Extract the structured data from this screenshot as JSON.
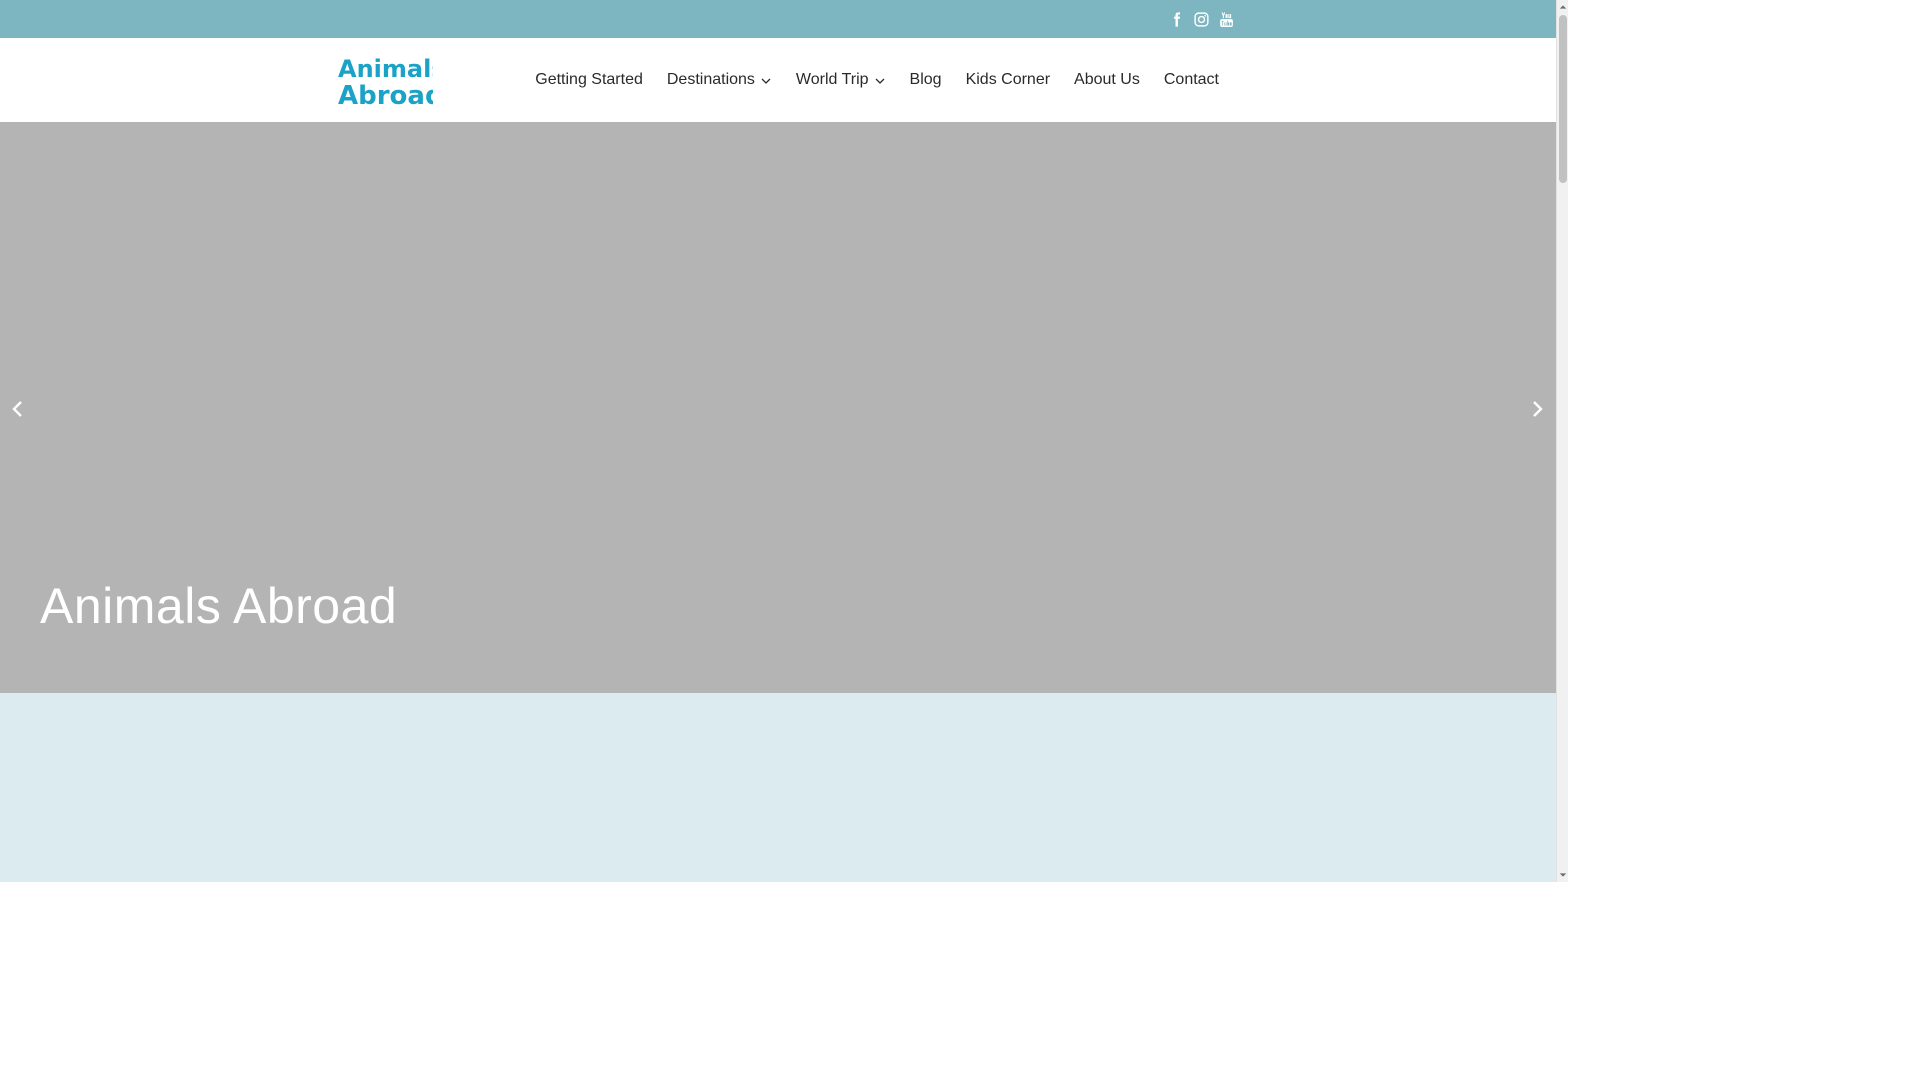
{
  "colors": {
    "topbar": "#7db6c1",
    "brand": "#1aa3c6",
    "hero_bg": "#b4b4b4",
    "below_bg": "#dcebef",
    "nav_text": "#2a2a2a"
  },
  "topbar": {
    "social": [
      {
        "icon": "facebook-icon"
      },
      {
        "icon": "instagram-icon"
      },
      {
        "icon": "youtube-icon"
      }
    ]
  },
  "header": {
    "logo": {
      "line1": "Animals",
      "line2": "Abroad"
    },
    "nav": [
      {
        "label": "Getting Started",
        "dropdown": false
      },
      {
        "label": "Destinations",
        "dropdown": true
      },
      {
        "label": "World Trip",
        "dropdown": true
      },
      {
        "label": "Blog",
        "dropdown": false
      },
      {
        "label": "Kids Corner",
        "dropdown": false
      },
      {
        "label": "About Us",
        "dropdown": false
      },
      {
        "label": "Contact",
        "dropdown": false
      }
    ]
  },
  "hero": {
    "title": "Animals Abroad",
    "prev_icon": "chevron-left-icon",
    "next_icon": "chevron-right-icon"
  }
}
